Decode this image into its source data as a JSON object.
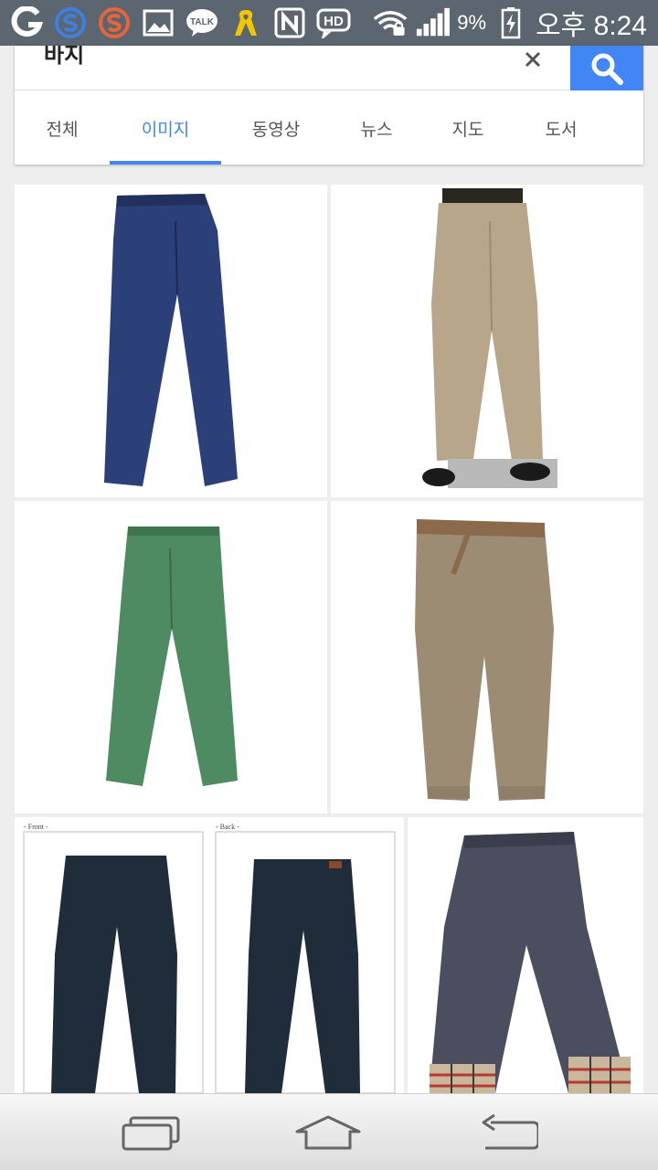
{
  "status_bar": {
    "battery_percent": "9%",
    "time": "오후 8:24",
    "icons": [
      "g-app-icon",
      "s-blue-icon",
      "s-orange-icon",
      "gallery-icon",
      "kakaotalk-icon",
      "yellow-ribbon-icon",
      "nfc-icon",
      "hd-voice-icon",
      "wifi-icon",
      "signal-icon",
      "battery-charging-icon"
    ],
    "talk_label": "TALK",
    "hd_label": "HD"
  },
  "search": {
    "query": "바지",
    "clear_icon": "close-icon",
    "submit_icon": "search-icon",
    "accent_color": "#4285f4"
  },
  "tabs": [
    {
      "label": "전체",
      "active": false
    },
    {
      "label": "이미지",
      "active": true
    },
    {
      "label": "동영상",
      "active": false
    },
    {
      "label": "뉴스",
      "active": false
    },
    {
      "label": "지도",
      "active": false
    },
    {
      "label": "도서",
      "active": false
    }
  ],
  "results": [
    {
      "name": "navy-slim-pants",
      "color": "#2b3f78"
    },
    {
      "name": "khaki-chinos-mannequin",
      "color": "#b8a68a"
    },
    {
      "name": "green-slim-pants",
      "color": "#4e8a62"
    },
    {
      "name": "beige-belted-pants",
      "color": "#9d8c74"
    },
    {
      "name": "dark-jeans-front-back",
      "color": "#1f2c3a",
      "captions": [
        "- Front -",
        "- Back -"
      ]
    },
    {
      "name": "kids-jeans-checked-cuffs",
      "color": "#4a4e5e"
    }
  ],
  "nav": {
    "recent_icon": "recent-apps-icon",
    "home_icon": "home-icon",
    "back_icon": "back-icon"
  }
}
